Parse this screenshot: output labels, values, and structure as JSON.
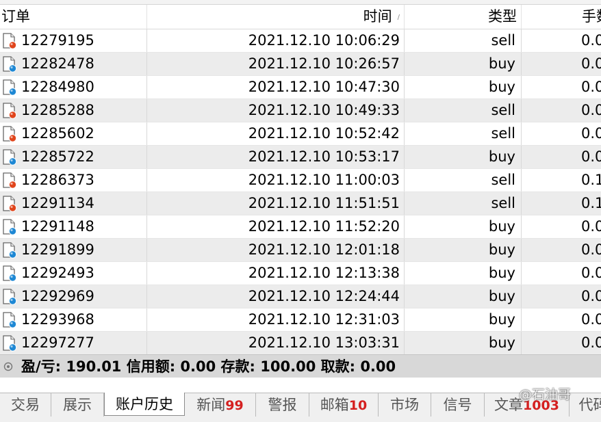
{
  "columns": {
    "order": "订单",
    "time": "时间",
    "type": "类型",
    "fee": "手数"
  },
  "sort_indicator": "/",
  "rows": [
    {
      "order": "12279195",
      "time": "2021.12.10 10:06:29",
      "type": "sell",
      "fee": "0.0",
      "icon": "sell-order-icon"
    },
    {
      "order": "12282478",
      "time": "2021.12.10 10:26:57",
      "type": "buy",
      "fee": "0.0",
      "icon": "buy-order-icon"
    },
    {
      "order": "12284980",
      "time": "2021.12.10 10:47:30",
      "type": "buy",
      "fee": "0.0",
      "icon": "buy-order-icon"
    },
    {
      "order": "12285288",
      "time": "2021.12.10 10:49:33",
      "type": "sell",
      "fee": "0.0",
      "icon": "sell-order-icon"
    },
    {
      "order": "12285602",
      "time": "2021.12.10 10:52:42",
      "type": "sell",
      "fee": "0.0",
      "icon": "sell-order-icon"
    },
    {
      "order": "12285722",
      "time": "2021.12.10 10:53:17",
      "type": "buy",
      "fee": "0.0",
      "icon": "buy-order-icon"
    },
    {
      "order": "12286373",
      "time": "2021.12.10 11:00:03",
      "type": "sell",
      "fee": "0.1",
      "icon": "sell-order-icon"
    },
    {
      "order": "12291134",
      "time": "2021.12.10 11:51:51",
      "type": "sell",
      "fee": "0.1",
      "icon": "sell-order-icon"
    },
    {
      "order": "12291148",
      "time": "2021.12.10 11:52:20",
      "type": "buy",
      "fee": "0.0",
      "icon": "buy-order-icon"
    },
    {
      "order": "12291899",
      "time": "2021.12.10 12:01:18",
      "type": "buy",
      "fee": "0.0",
      "icon": "buy-order-icon"
    },
    {
      "order": "12292493",
      "time": "2021.12.10 12:13:38",
      "type": "buy",
      "fee": "0.0",
      "icon": "buy-order-icon"
    },
    {
      "order": "12292969",
      "time": "2021.12.10 12:24:44",
      "type": "buy",
      "fee": "0.0",
      "icon": "buy-order-icon"
    },
    {
      "order": "12293968",
      "time": "2021.12.10 12:31:03",
      "type": "buy",
      "fee": "0.0",
      "icon": "buy-order-icon"
    },
    {
      "order": "12297277",
      "time": "2021.12.10 13:03:31",
      "type": "buy",
      "fee": "0.0",
      "icon": "buy-order-icon"
    }
  ],
  "summary": {
    "text": "盈/亏: 190.01  信用额: 0.00  存款: 100.00  取款: 0.00"
  },
  "tabs": [
    {
      "label": "交易",
      "badge": ""
    },
    {
      "label": "展示",
      "badge": ""
    },
    {
      "label": "账户历史",
      "badge": "",
      "active": true
    },
    {
      "label": "新闻",
      "badge": "99"
    },
    {
      "label": "警报",
      "badge": ""
    },
    {
      "label": "邮箱",
      "badge": "10"
    },
    {
      "label": "市场",
      "badge": ""
    },
    {
      "label": "信号",
      "badge": ""
    },
    {
      "label": "文章",
      "badge": "1003"
    },
    {
      "label": "代码",
      "badge": ""
    }
  ],
  "watermark": "@石油哥",
  "colors": {
    "sell": "#e0451c",
    "buy": "#1e88d4",
    "badge": "#d42020",
    "alt_row": "#ececec",
    "summary_bg": "#d8d8d8"
  }
}
